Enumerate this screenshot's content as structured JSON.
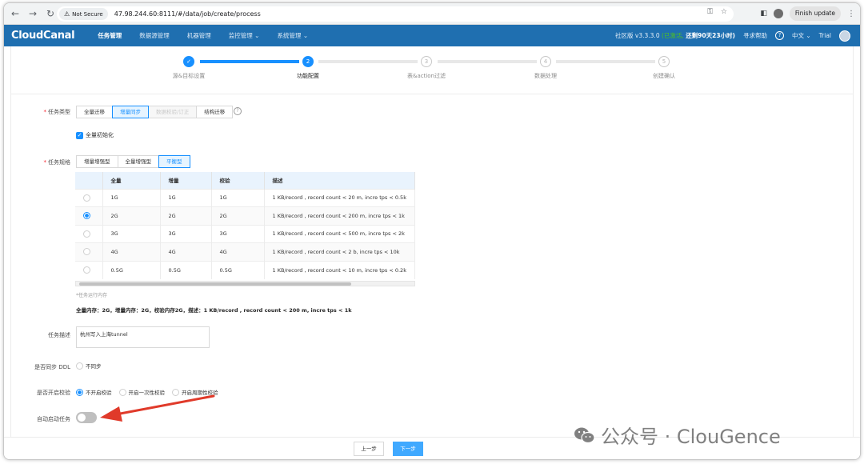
{
  "browser": {
    "security_label": "Not Secure",
    "url": "47.98.244.60:8111/#/data/job/create/process",
    "finish_update": "Finish update"
  },
  "header": {
    "logo": "CloudCanal",
    "menu": [
      "任务管理",
      "数据源管理",
      "机器管理",
      "监控管理 ⌄",
      "系统管理 ⌄"
    ],
    "edition": "社区版 v3.3.3.0",
    "activation": "(已激活,",
    "remaining": "还剩90天23小时)",
    "help": "寻求帮助",
    "help_icon": "?",
    "language": "中文 ⌄",
    "user": "Trial"
  },
  "steps": [
    {
      "num": "✓",
      "label": "源&目标设置",
      "state": "done"
    },
    {
      "num": "2",
      "label": "功能配置",
      "state": "current"
    },
    {
      "num": "3",
      "label": "表&action过滤",
      "state": "todo"
    },
    {
      "num": "4",
      "label": "数据处理",
      "state": "todo"
    },
    {
      "num": "5",
      "label": "创建确认",
      "state": "todo"
    }
  ],
  "task_type": {
    "label": "任务类型",
    "options": [
      "全量迁移",
      "增量同步",
      "数据校验/订正",
      "结构迁移"
    ],
    "selected": "增量同步",
    "help_icon": "?"
  },
  "full_init": {
    "label": "全量初始化",
    "checked": true
  },
  "spec": {
    "label": "任务规格",
    "options": [
      "增量增强型",
      "全量增强型",
      "平衡型"
    ],
    "selected": "平衡型",
    "columns": [
      "",
      "全量",
      "增量",
      "校验",
      "描述"
    ],
    "rows": [
      {
        "full": "1G",
        "incr": "1G",
        "check": "1G",
        "desc": "1 KB/record , record count < 20 m, incre tps < 0.5k",
        "selected": false
      },
      {
        "full": "2G",
        "incr": "2G",
        "check": "2G",
        "desc": "1 KB/record , record count < 200 m, incre tps < 1k",
        "selected": true
      },
      {
        "full": "3G",
        "incr": "3G",
        "check": "3G",
        "desc": "1 KB/record , record count < 500 m, incre tps < 2k",
        "selected": false
      },
      {
        "full": "4G",
        "incr": "4G",
        "check": "4G",
        "desc": "1 KB/record , record count < 2 b, incre tps < 10k",
        "selected": false
      },
      {
        "full": "0.5G",
        "incr": "0.5G",
        "check": "0.5G",
        "desc": "1 KB/record , record count < 10 m, incre tps < 0.2k",
        "selected": false
      }
    ],
    "note": "*任务运行内存",
    "summary": "全量内存：2G，增量内存：2G，校验内存2G，描述：1 KB/record , record count < 200 m, incre tps < 1k"
  },
  "description": {
    "label": "任务描述",
    "value": "杭州写入上海tunnel"
  },
  "ddl_sync": {
    "label": "是否同步 DDL",
    "option": "不同步"
  },
  "check": {
    "label": "是否开启校验",
    "options": [
      "不开启校验",
      "开启一次性校验",
      "开启周期性校验"
    ],
    "selected": "不开启校验"
  },
  "auto_start": {
    "label": "自动启动任务",
    "on": false
  },
  "footer": {
    "prev": "上一步",
    "next": "下一步"
  },
  "watermark": "公众号 · ClouGence",
  "colors": {
    "header": "#1f6fb0",
    "primary": "#1890ff",
    "arrow": "#e03a2a"
  }
}
